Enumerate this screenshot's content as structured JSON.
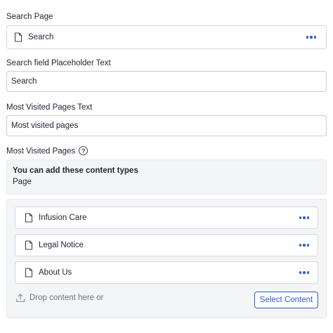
{
  "search_page": {
    "label": "Search Page",
    "value": "Search"
  },
  "placeholder_field": {
    "label": "Search field Placeholder Text",
    "value": "Search"
  },
  "most_visited_text": {
    "label": "Most Visited Pages Text",
    "value": "Most visited pages"
  },
  "most_visited_pages": {
    "label": "Most Visited Pages",
    "help_icon": "?",
    "info_title": "You can add these content types",
    "info_types": "Page",
    "items": [
      {
        "label": "Infusion Care"
      },
      {
        "label": "Legal Notice"
      },
      {
        "label": "About Us"
      }
    ],
    "drop_text": "Drop content here or",
    "select_button": "Select Content"
  },
  "colors": {
    "accent": "#2f5bd3",
    "panel_bg": "#f4f5f7",
    "border": "#d4d8de"
  },
  "icons": {
    "document": "document-icon",
    "more": "more-dots-icon",
    "upload": "upload-icon",
    "help": "help-circle-icon"
  }
}
